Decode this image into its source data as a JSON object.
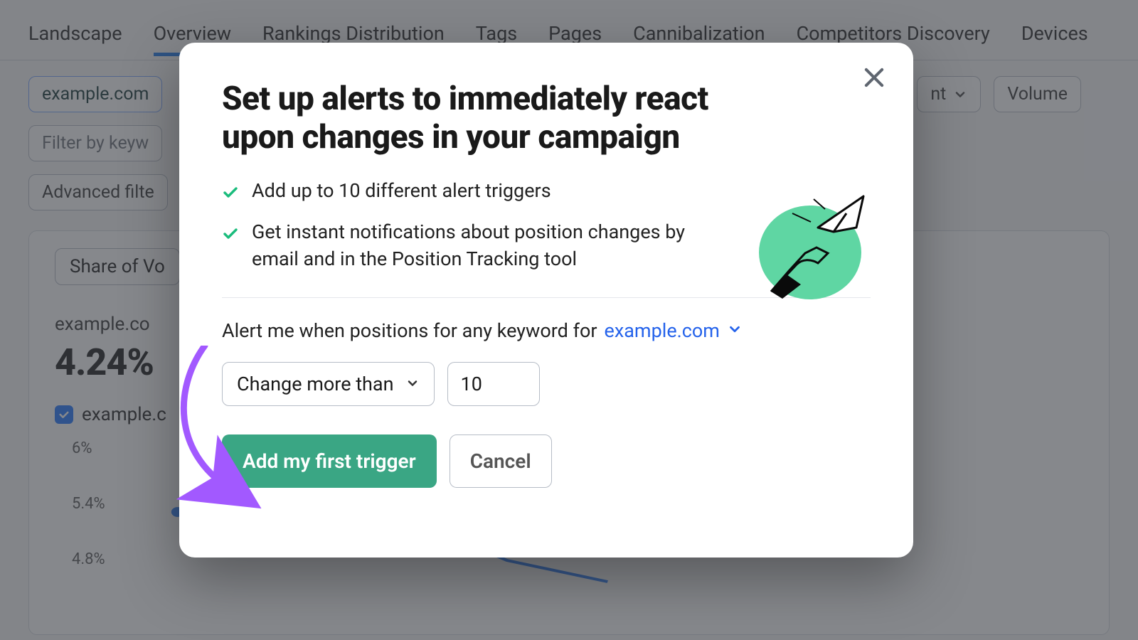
{
  "tabs": {
    "items": [
      "Landscape",
      "Overview",
      "Rankings Distribution",
      "Tags",
      "Pages",
      "Cannibalization",
      "Competitors Discovery",
      "Devices"
    ],
    "active_index": 1
  },
  "filters": {
    "domain": "example.com",
    "keyword_filter_placeholder": "Filter by keyw",
    "advanced_label": "Advanced filte",
    "intent_partial": "nt",
    "volume_partial": "Volume"
  },
  "card": {
    "sov_label": "Share of Vo",
    "kpi_label": "example.co",
    "kpi_value": "4.24%",
    "legend_label": "example.c",
    "y_ticks": [
      "6%",
      "5.4%",
      "4.8%"
    ]
  },
  "modal": {
    "title": "Set up alerts to immediately react upon changes in your campaign",
    "bullets": [
      "Add up to 10 different alert triggers",
      "Get instant notifications about position changes by email and in the Position Tracking tool"
    ],
    "sentence_prefix": "Alert me when positions for any keyword for",
    "domain": "example.com",
    "condition_label": "Change more than",
    "threshold": "10",
    "primary": "Add my first trigger",
    "secondary": "Cancel"
  },
  "colors": {
    "accent_green": "#3aa684",
    "link_blue": "#2563eb",
    "arrow": "#a259ff"
  }
}
